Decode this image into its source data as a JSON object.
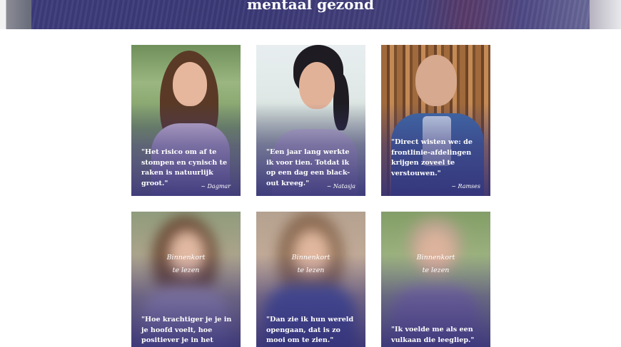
{
  "hero": {
    "title": "mentaal gezond"
  },
  "featured": [
    {
      "quote": "\"Het risico om af te stompen en cynisch te raken is natuurlijk groot.\"",
      "name": "~ Dagmar"
    },
    {
      "quote": "\"Een jaar lang werkte ik voor tien. Totdat ik op een dag een black-out kreeg.\"",
      "name": "~ Natasja"
    },
    {
      "quote": "\"Direct wisten we: de frontlinie-afdelingen krijgen zoveel te verstouwen.\"",
      "name": "~ Ramses"
    }
  ],
  "upcoming": [
    {
      "soon_line1": "Binnenkort",
      "soon_line2": "te lezen",
      "quote": "\"Hoe krachtiger je je in je hoofd voelt, hoe positiever je in het leven staat.\""
    },
    {
      "soon_line1": "Binnenkort",
      "soon_line2": "te lezen",
      "quote": "\"Dan zie ik hun wereld opengaan, dat is zo mooi om te zien.\""
    },
    {
      "soon_line1": "Binnenkort",
      "soon_line2": "te lezen",
      "quote": "\"Ik voelde me als een vulkaan die leegliep.\""
    }
  ]
}
